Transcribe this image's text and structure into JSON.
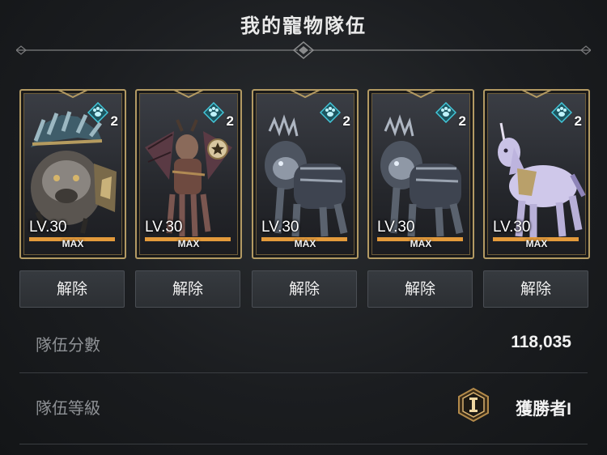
{
  "title": "我的寵物隊伍",
  "pets": [
    {
      "level": "LV.30",
      "max": "MAX",
      "slot_count": "2",
      "icon": "paw-icon"
    },
    {
      "level": "LV.30",
      "max": "MAX",
      "slot_count": "2",
      "icon": "paw-icon"
    },
    {
      "level": "LV.30",
      "max": "MAX",
      "slot_count": "2",
      "icon": "paw-icon"
    },
    {
      "level": "LV.30",
      "max": "MAX",
      "slot_count": "2",
      "icon": "paw-icon"
    },
    {
      "level": "LV.30",
      "max": "MAX",
      "slot_count": "2",
      "icon": "paw-icon"
    }
  ],
  "release_label": "解除",
  "team_score": {
    "label": "隊伍分數",
    "value": "118,035"
  },
  "team_rank": {
    "label": "隊伍等級",
    "value": "獲勝者I",
    "icon": "rank-emblem-icon"
  },
  "colors": {
    "accent_gold": "#b39a63",
    "level_bar": "#e39a3b",
    "paw_cyan": "#43c7d9"
  }
}
